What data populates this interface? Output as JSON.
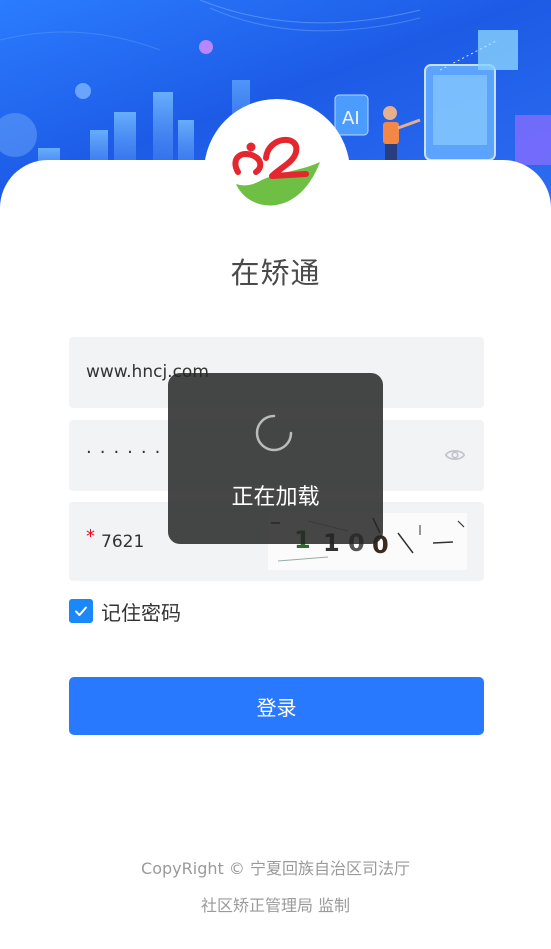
{
  "app": {
    "title": "在矫通"
  },
  "form": {
    "username_value": "www.hncj.com",
    "password_value": "······",
    "captcha_value": "7621",
    "captcha_image_text": "1100",
    "required_mark": "*"
  },
  "remember": {
    "label": "记住密码",
    "checked": true
  },
  "login_button": {
    "label": "登录"
  },
  "footer": {
    "line1": "CopyRight © 宁夏回族自治区司法厅",
    "line2": "社区矫正管理局 监制"
  },
  "loading": {
    "text": "正在加载"
  },
  "colors": {
    "primary": "#2979ff",
    "checkbox": "#1989fa",
    "required": "#ee0a24"
  },
  "icons": [
    "app-logo",
    "eye-icon",
    "check-icon",
    "loading-spinner-icon"
  ]
}
